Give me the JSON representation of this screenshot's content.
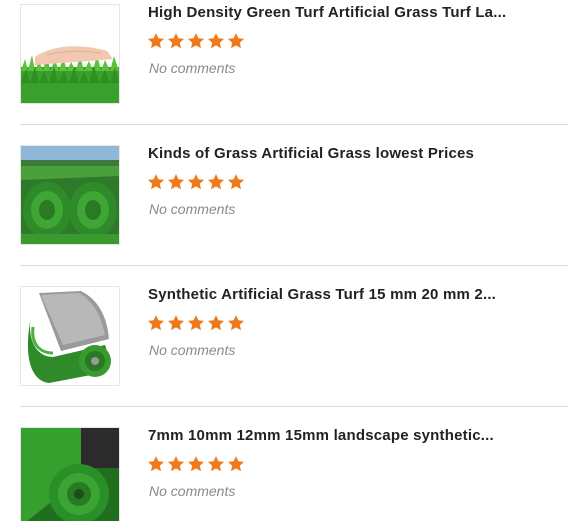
{
  "products": [
    {
      "title": "High Density Green Turf Artificial Grass Turf La...",
      "rating": 5,
      "comments": "No comments",
      "thumb_icon": "grass-hand-photo"
    },
    {
      "title": "Kinds of Grass Artificial Grass lowest Prices",
      "rating": 5,
      "comments": "No comments",
      "thumb_icon": "grass-rolls-photo"
    },
    {
      "title": "Synthetic Artificial Grass Turf 15 mm 20 mm 2...",
      "rating": 5,
      "comments": "No comments",
      "thumb_icon": "grass-roll-photo"
    },
    {
      "title": "7mm 10mm 12mm 15mm landscape synthetic...",
      "rating": 5,
      "comments": "No comments",
      "thumb_icon": "grass-carpet-roll-photo"
    }
  ],
  "colors": {
    "star": "#f07a1a",
    "title": "#222222",
    "comments": "#8a8a8a",
    "divider": "#dcdcdc"
  }
}
